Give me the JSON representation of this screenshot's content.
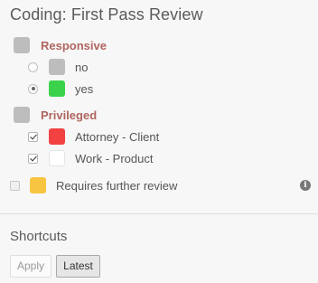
{
  "panel": {
    "title": "Coding: First Pass Review"
  },
  "groups": {
    "responsive": {
      "label": "Responsive",
      "color": "#bdbdbd",
      "choices": [
        {
          "label": "no",
          "color": "#bdbdbd",
          "selected": false
        },
        {
          "label": "yes",
          "color": "#3ad24a",
          "selected": true
        }
      ]
    },
    "privileged": {
      "label": "Privileged",
      "color": "#bdbdbd",
      "choices": [
        {
          "label": "Attorney - Client",
          "color": "#f24141",
          "checked": true
        },
        {
          "label": "Work - Product",
          "color": "#ffffff",
          "checked": true
        }
      ]
    }
  },
  "further_review": {
    "label": "Requires further review",
    "color": "#f7c542",
    "checked": false,
    "info_icon": "info-icon"
  },
  "shortcuts": {
    "title": "Shortcuts",
    "apply_label": "Apply",
    "latest_label": "Latest"
  },
  "colors": {
    "group_label": "#b0655f",
    "background": "#f7f7f7"
  }
}
